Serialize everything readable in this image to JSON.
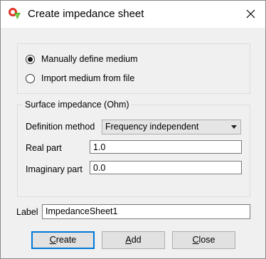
{
  "window": {
    "title": "Create impedance sheet",
    "app_icon": "cst-app-icon",
    "close_icon": "close-icon"
  },
  "medium": {
    "options": [
      {
        "label": "Manually define medium",
        "checked": true
      },
      {
        "label": "Import medium from file",
        "checked": false
      }
    ]
  },
  "surface_impedance": {
    "group_title": "Surface impedance (Ohm)",
    "definition_method_label": "Definition method",
    "definition_method_value": "Frequency independent",
    "real_part_label": "Real part",
    "real_part_value": "1.0",
    "imaginary_part_label": "Imaginary part",
    "imaginary_part_value": "0.0"
  },
  "label_field": {
    "label": "Label",
    "value": "ImpedanceSheet1"
  },
  "buttons": {
    "create_prefix": "",
    "create_mnemonic": "C",
    "create_rest": "reate",
    "add_prefix": "",
    "add_mnemonic": "A",
    "add_rest": "dd",
    "close_prefix": "",
    "close_mnemonic": "C",
    "close_rest": "lose"
  },
  "colors": {
    "window_bg": "#f0f0f0",
    "titlebar_bg": "#ffffff",
    "default_button_border": "#0078d7"
  }
}
